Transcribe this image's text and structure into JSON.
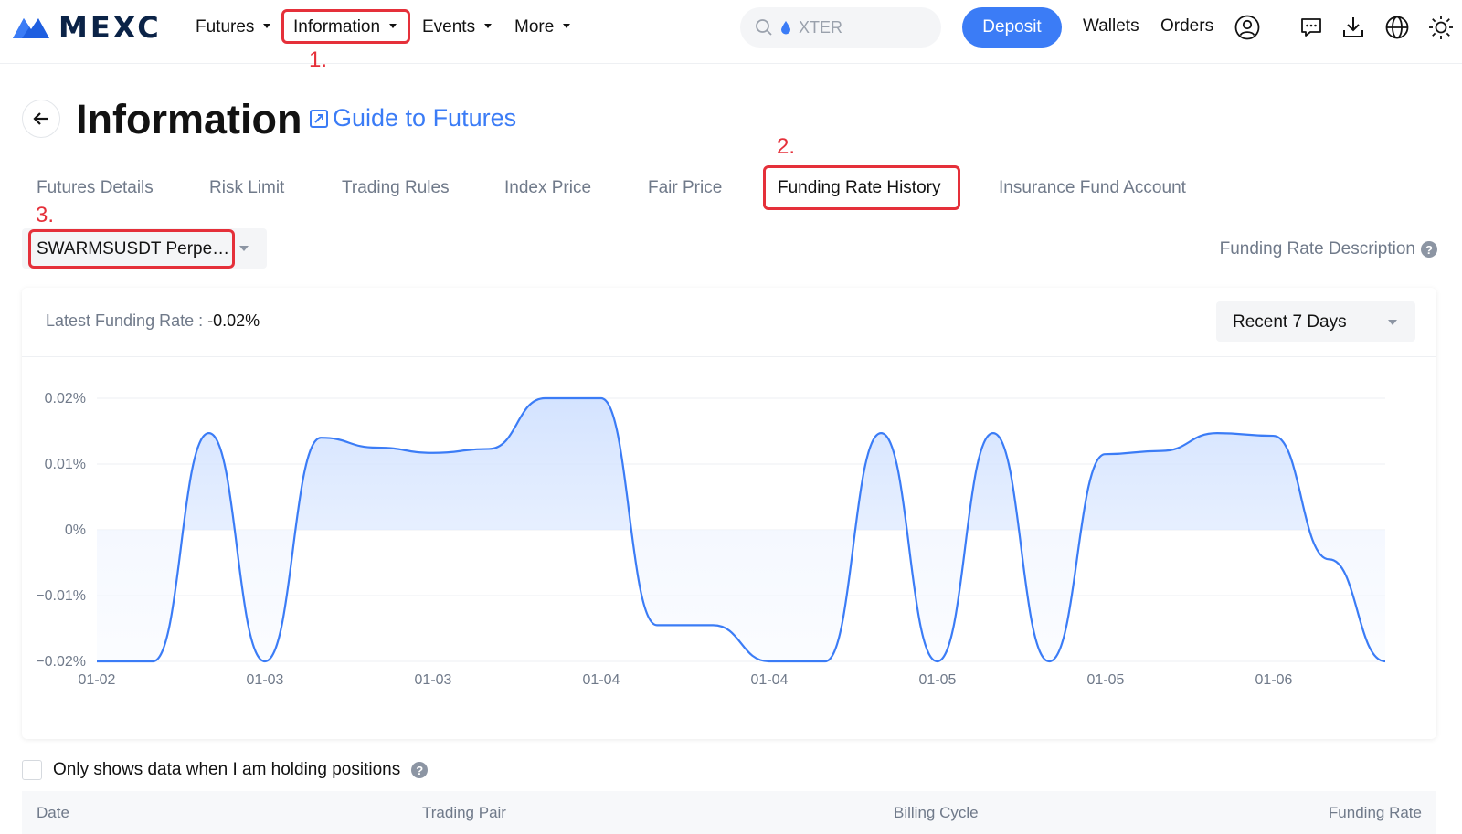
{
  "header": {
    "logo_text": "MEXC",
    "nav": [
      {
        "label": "Futures"
      },
      {
        "label": "Information"
      },
      {
        "label": "Events"
      },
      {
        "label": "More"
      }
    ],
    "search_placeholder": "XTER",
    "deposit_label": "Deposit",
    "wallets_label": "Wallets",
    "orders_label": "Orders",
    "icons": [
      "user-icon",
      "chat-icon",
      "download-icon",
      "globe-icon",
      "sun-icon"
    ]
  },
  "annotations": {
    "step1": "1.",
    "step2": "2.",
    "step3": "3.",
    "color": "#e5303a"
  },
  "page": {
    "title": "Information",
    "guide_link": "Guide to Futures"
  },
  "tabs": [
    {
      "label": "Futures Details"
    },
    {
      "label": "Risk Limit"
    },
    {
      "label": "Trading Rules"
    },
    {
      "label": "Index Price"
    },
    {
      "label": "Fair Price"
    },
    {
      "label": "Funding Rate History",
      "active": true
    },
    {
      "label": "Insurance Fund Account"
    }
  ],
  "symbol_selector": {
    "value": "SWARMSUSDT Perpetual"
  },
  "funding_rate_description": "Funding Rate Description",
  "latest_funding": {
    "label": "Latest Funding Rate :",
    "value": "-0.02%"
  },
  "range_selector": {
    "value": "Recent 7 Days"
  },
  "chart_data": {
    "type": "area",
    "ylim": [
      -0.02,
      0.02
    ],
    "ytick_labels": [
      "0.02%",
      "0.01%",
      "0%",
      "−0.01%",
      "−0.02%"
    ],
    "yticks": [
      0.02,
      0.01,
      0,
      -0.01,
      -0.02
    ],
    "xtick_labels": [
      "01-02",
      "01-03",
      "01-03",
      "01-04",
      "01-04",
      "01-05",
      "01-05",
      "01-06"
    ],
    "series": [
      {
        "values": [
          -0.02,
          -0.02,
          0.0147,
          -0.02,
          0.014,
          0.0125,
          0.0117,
          0.0123,
          0.02,
          0.02,
          -0.0145,
          -0.0145,
          -0.02,
          -0.02,
          0.0147,
          -0.02,
          0.0147,
          -0.02,
          0.0115,
          0.012,
          0.0147,
          0.0143,
          -0.0045,
          -0.02
        ]
      }
    ],
    "grid": true,
    "line_color": "#3b7cf6",
    "fill_color": "#e6efff"
  },
  "holding_filter": {
    "label": "Only shows data when I am holding positions"
  },
  "table": {
    "columns": [
      "Date",
      "Trading Pair",
      "Billing Cycle",
      "Funding Rate"
    ]
  },
  "colors": {
    "accent": "#3b7cf6",
    "text": "#121212",
    "muted": "#707a8a"
  }
}
